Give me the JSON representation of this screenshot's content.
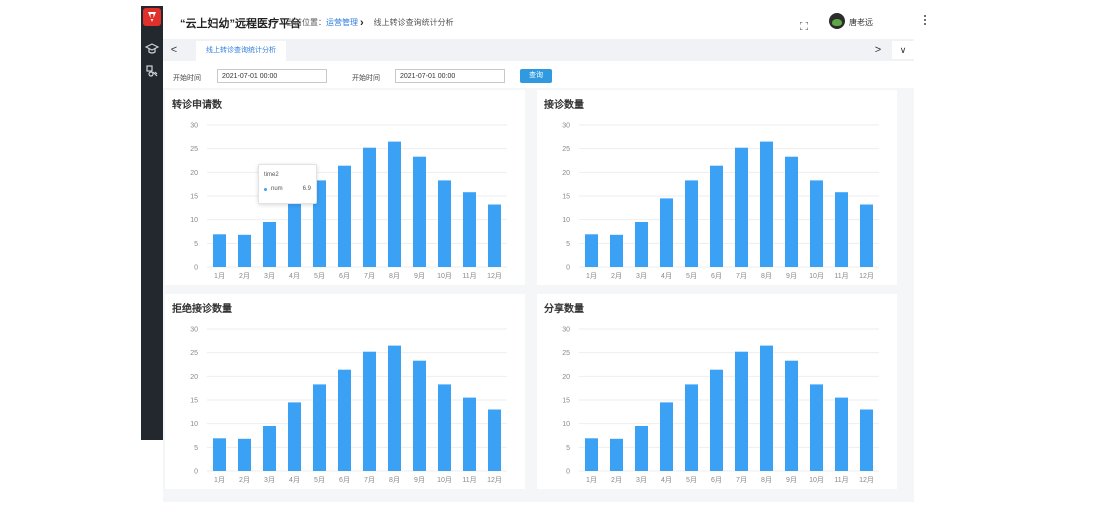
{
  "app": {
    "title": "“云上妇幼”远程医疗平台"
  },
  "header": {
    "breadcrumb_prefix": "当前位置：",
    "breadcrumb_link": "运营管理",
    "breadcrumb_current": "线上转诊查询统计分析",
    "user_name": "唐老远"
  },
  "tabs": {
    "prev_label": "<",
    "items": [
      {
        "label": "线上转诊查询统计分析"
      }
    ],
    "next_label": ">",
    "dropdown_label": "∨"
  },
  "filter": {
    "start_label_1": "开始时间",
    "start_value_1": "2021-07-01 00:00",
    "start_label_2": "开始时间",
    "start_value_2": "2021-07-01 00:00",
    "query_button": "查询"
  },
  "icons": {
    "logo": "hospital-logo-icon",
    "nav_1": "graduation-cap-icon",
    "nav_2": "tools-icon",
    "fullscreen": "fullscreen-icon",
    "more": "more-vertical-icon"
  },
  "colors": {
    "bar": "#3aa1f5",
    "logo": "#e0302a",
    "primary": "#2f9ae0"
  },
  "tooltip": {
    "title": "time2",
    "series": "num",
    "value": "6.9"
  },
  "chart_data": [
    {
      "type": "bar",
      "title": "转诊申请数",
      "categories": [
        "1月",
        "2月",
        "3月",
        "4月",
        "5月",
        "6月",
        "7月",
        "8月",
        "9月",
        "10月",
        "11月",
        "12月"
      ],
      "values": [
        6.9,
        6.8,
        9.5,
        14.5,
        18.3,
        21.4,
        25.2,
        26.5,
        23.3,
        18.3,
        15.8,
        13.2
      ],
      "ylim": [
        0,
        30
      ],
      "yticks": [
        "0",
        "5",
        "10",
        "15",
        "20",
        "25",
        "30"
      ],
      "grid": true
    },
    {
      "type": "bar",
      "title": "接诊数量",
      "categories": [
        "1月",
        "2月",
        "3月",
        "4月",
        "5月",
        "6月",
        "7月",
        "8月",
        "9月",
        "10月",
        "11月",
        "12月"
      ],
      "values": [
        6.9,
        6.8,
        9.5,
        14.5,
        18.3,
        21.4,
        25.2,
        26.5,
        23.3,
        18.3,
        15.8,
        13.2
      ],
      "ylim": [
        0,
        30
      ],
      "yticks": [
        "0",
        "5",
        "10",
        "15",
        "20",
        "25",
        "30"
      ],
      "grid": true
    },
    {
      "type": "bar",
      "title": "拒绝接诊数量",
      "categories": [
        "1月",
        "2月",
        "3月",
        "4月",
        "5月",
        "6月",
        "7月",
        "8月",
        "9月",
        "10月",
        "11月",
        "12月"
      ],
      "values": [
        6.9,
        6.8,
        9.5,
        14.5,
        18.3,
        21.4,
        25.2,
        26.5,
        23.3,
        18.3,
        15.5,
        13.0
      ],
      "ylim": [
        0,
        30
      ],
      "yticks": [
        "0",
        "5",
        "10",
        "15",
        "20",
        "25",
        "30"
      ],
      "grid": true
    },
    {
      "type": "bar",
      "title": "分享数量",
      "categories": [
        "1月",
        "2月",
        "3月",
        "4月",
        "5月",
        "6月",
        "7月",
        "8月",
        "9月",
        "10月",
        "11月",
        "12月"
      ],
      "values": [
        6.9,
        6.8,
        9.5,
        14.5,
        18.3,
        21.4,
        25.2,
        26.5,
        23.3,
        18.3,
        15.5,
        13.0
      ],
      "ylim": [
        0,
        30
      ],
      "yticks": [
        "0",
        "5",
        "10",
        "15",
        "20",
        "25",
        "30"
      ],
      "grid": true
    }
  ]
}
